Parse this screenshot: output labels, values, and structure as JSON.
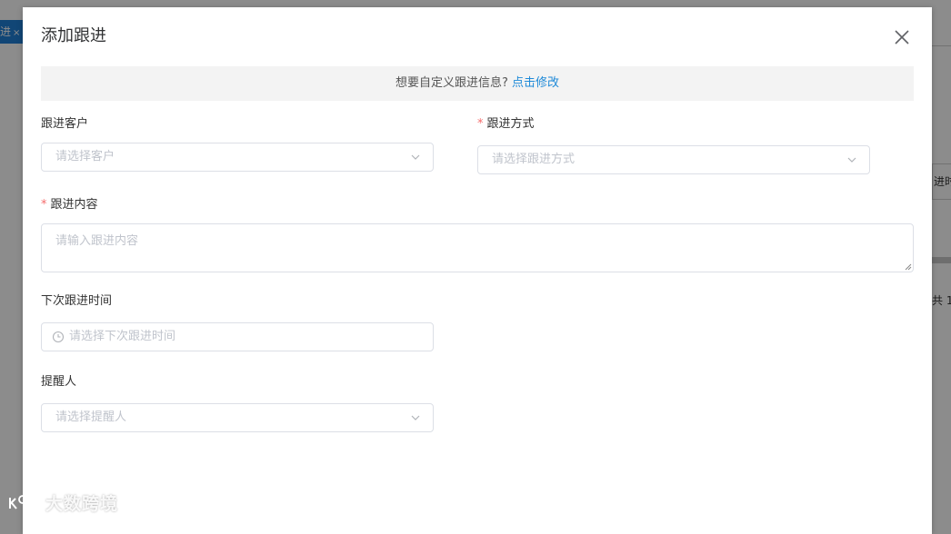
{
  "background": {
    "tab_label": "进",
    "tab_close": "×",
    "side_button": "进时",
    "total_text": "共 1"
  },
  "dialog": {
    "title": "添加跟进",
    "banner": {
      "text": "想要自定义跟进信息?",
      "link": "点击修改"
    },
    "fields": {
      "customer": {
        "label": "跟进客户",
        "placeholder": "请选择客户"
      },
      "method": {
        "label": "跟进方式",
        "placeholder": "请选择跟进方式",
        "required": "*"
      },
      "content": {
        "label": "跟进内容",
        "placeholder": "请输入跟进内容",
        "required": "*"
      },
      "next_time": {
        "label": "下次跟进时间",
        "placeholder": "请选择下次跟进时间"
      },
      "reminder": {
        "label": "提醒人",
        "placeholder": "请选择提醒人"
      }
    }
  },
  "watermark": "大数跨境",
  "colors": {
    "primary": "#1f8ad8",
    "required": "#f56c6c",
    "banner_bg": "#f3f3f3",
    "border": "#dcdfe6",
    "placeholder": "#c0c4cc"
  }
}
